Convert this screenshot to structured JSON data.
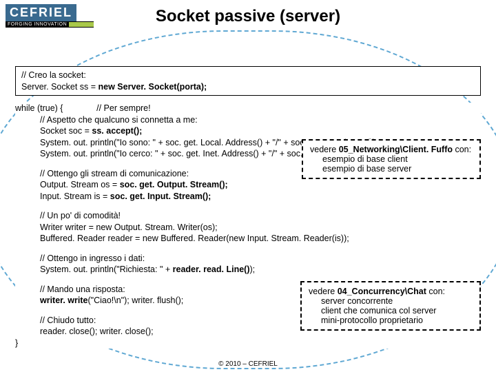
{
  "logo": {
    "main": "CEFRIEL",
    "sub1": "FORGING INNOVATION",
    "sub2": ""
  },
  "title": "Socket passive (server)",
  "code_top": {
    "c1": "// Creo la socket:",
    "c2_a": "Server. Socket ss = ",
    "c2_b": "new Server. Socket(porta);"
  },
  "code_main": {
    "l1_a": "while (true) {",
    "l1_b": "// Per sempre!",
    "l2": "// Aspetto che qualcuno si connetta a me:",
    "l3_a": "Socket soc = ",
    "l3_b": "ss. accept();",
    "l4": "System. out. println(\"Io sono: \" + soc. get. Local. Address() + \"/\" + soc. get. Local. Port());",
    "l5": "System. out. println(\"Io cerco: \" + soc. get. Inet. Address() + \"/\" + soc. get. Port());",
    "b2_c": "// Ottengo gli stream di comunicazione:",
    "b2_1a": "Output. Stream os = ",
    "b2_1b": "soc. get. Output. Stream();",
    "b2_2a": "Input. Stream is = ",
    "b2_2b": "soc. get. Input. Stream();",
    "b3_c": "// Un po' di comodità!",
    "b3_1": "Writer writer = new Output. Stream. Writer(os);",
    "b3_2": "Buffered. Reader reader = new Buffered. Reader(new Input. Stream. Reader(is));",
    "b4_c": "// Ottengo in ingresso i dati:",
    "b4_1a": "System. out. println(\"Richiesta: \" + ",
    "b4_1b": "reader. read. Line()",
    "b4_1c": ");",
    "b5_c": "// Mando una risposta:",
    "b5_1a": "writer. write",
    "b5_1b": "(\"Ciao!\\n\"); writer. flush();",
    "b6_c": "// Chiudo tutto:",
    "b6_1": "reader. close(); writer. close();",
    "end": "}"
  },
  "callout1": {
    "pre": "vedere ",
    "bold": "05_Networking\\Client. Fuffo",
    "post": " con:",
    "li1": "esempio di base client",
    "li2": "esempio di base server"
  },
  "callout2": {
    "pre": "vedere ",
    "bold": "04_Concurrency\\Chat",
    "post": " con:",
    "li1": "server concorrente",
    "li2": "client che comunica col server",
    "li3": "mini-protocollo proprietario"
  },
  "footer": "© 2010 – CEFRIEL"
}
